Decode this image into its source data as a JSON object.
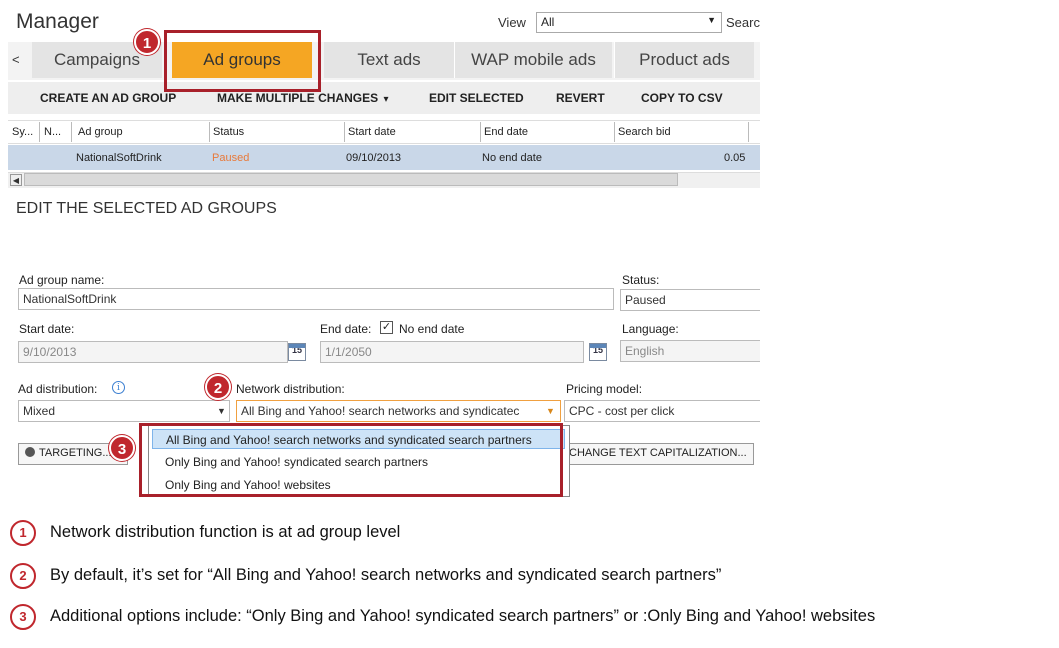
{
  "app": {
    "title": "Manager",
    "view_label": "View",
    "view_value": "All",
    "search_label": "Searc"
  },
  "tabs": {
    "prev_label": "<",
    "items": [
      {
        "label": "Campaigns"
      },
      {
        "label": "Ad groups",
        "active": true
      },
      {
        "label": "Text ads"
      },
      {
        "label": "WAP mobile ads"
      },
      {
        "label": "Product ads"
      }
    ]
  },
  "toolbar": {
    "create": "CREATE AN AD GROUP",
    "multiple": "MAKE MULTIPLE CHANGES",
    "multiple_arrow": "▾",
    "edit": "EDIT SELECTED",
    "revert": "REVERT",
    "copy": "COPY TO CSV"
  },
  "grid": {
    "columns": [
      "Sy...",
      "N...",
      "Ad group",
      "Status",
      "Start date",
      "End date",
      "Search bid"
    ],
    "rows": [
      {
        "ad_group": "NationalSoftDrink",
        "status": "Paused",
        "start_date": "09/10/2013",
        "end_date": "No end date",
        "search_bid": "0.05"
      }
    ]
  },
  "edit": {
    "section_title": "EDIT THE SELECTED AD GROUPS",
    "ad_group_name_label": "Ad group name:",
    "ad_group_name_value": "NationalSoftDrink",
    "status_label": "Status:",
    "status_value": "Paused",
    "start_date_label": "Start date:",
    "start_date_value": "9/10/2013",
    "calendar_day": "15",
    "end_date_label": "End date:",
    "no_end_date_label": "No end date",
    "end_date_value": "1/1/2050",
    "language_label": "Language:",
    "language_value": "English",
    "ad_distribution_label": "Ad distribution:",
    "ad_distribution_value": "Mixed",
    "network_distribution_label": "Network distribution:",
    "network_distribution_value": "All Bing and Yahoo! search networks and syndicatec",
    "pricing_model_label": "Pricing model:",
    "pricing_model_value": "CPC - cost per click",
    "targeting_button": "TARGETING...",
    "change_text_cap_button": "CHANGE TEXT CAPITALIZATION..."
  },
  "network_options": [
    "All Bing and Yahoo! search networks and syndicated search partners",
    "Only Bing and Yahoo! syndicated search partners",
    "Only Bing and Yahoo! websites"
  ],
  "badges": [
    "1",
    "2",
    "3"
  ],
  "notes": [
    {
      "num": "1",
      "text": "Network distribution function is at ad group level"
    },
    {
      "num": "2",
      "text": "By default, it’s set for “All Bing and Yahoo! search networks and syndicated search partners”"
    },
    {
      "num": "3",
      "text": "Additional options include: “Only Bing and Yahoo! syndicated search partners” or :Only Bing and Yahoo! websites"
    }
  ],
  "colors": {
    "accent_tab": "#f5a623",
    "annotation_red": "#c0272d",
    "selected_row": "#c9d7e8"
  }
}
